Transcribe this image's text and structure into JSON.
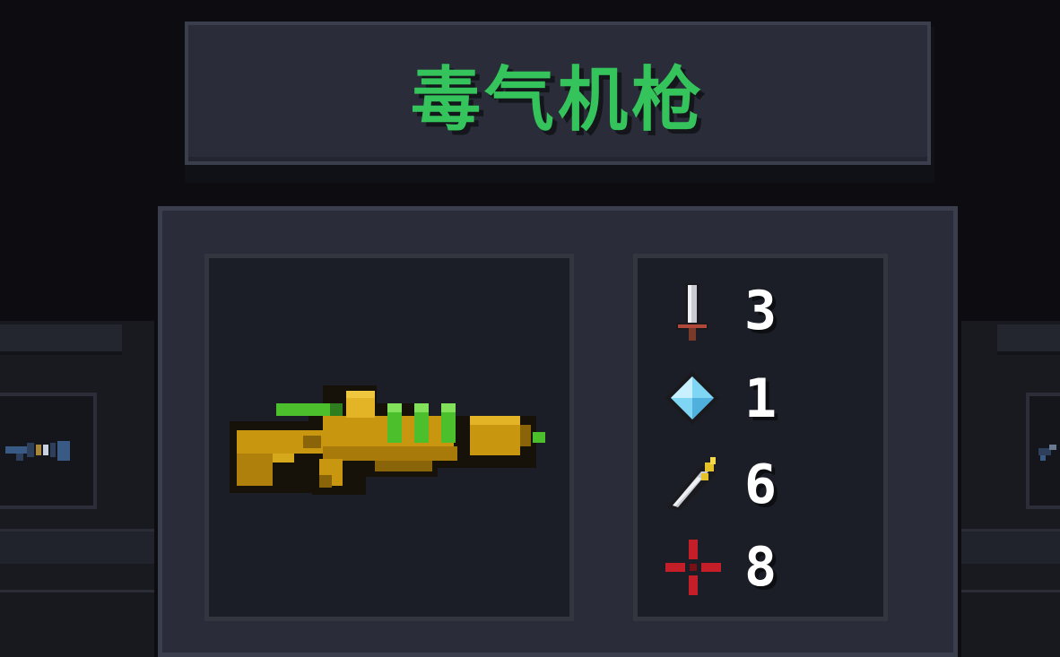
{
  "weapon": {
    "name": "毒气机枪",
    "icon": "toxic-gas-machine-gun-icon",
    "colors": {
      "name": "#35c45b",
      "body": "#c8960f",
      "accent": "#4cc02c"
    }
  },
  "stats": [
    {
      "id": "damage",
      "icon": "sword-icon",
      "value": "3"
    },
    {
      "id": "energy-cost",
      "icon": "blue-crystal-icon",
      "value": "1"
    },
    {
      "id": "critical",
      "icon": "feather-knife-icon",
      "value": "6"
    },
    {
      "id": "accuracy",
      "icon": "red-crosshair-icon",
      "value": "8"
    }
  ],
  "neighbors": {
    "left_icon": "left-weapon-preview-icon",
    "right_icon": "right-weapon-preview-icon"
  }
}
